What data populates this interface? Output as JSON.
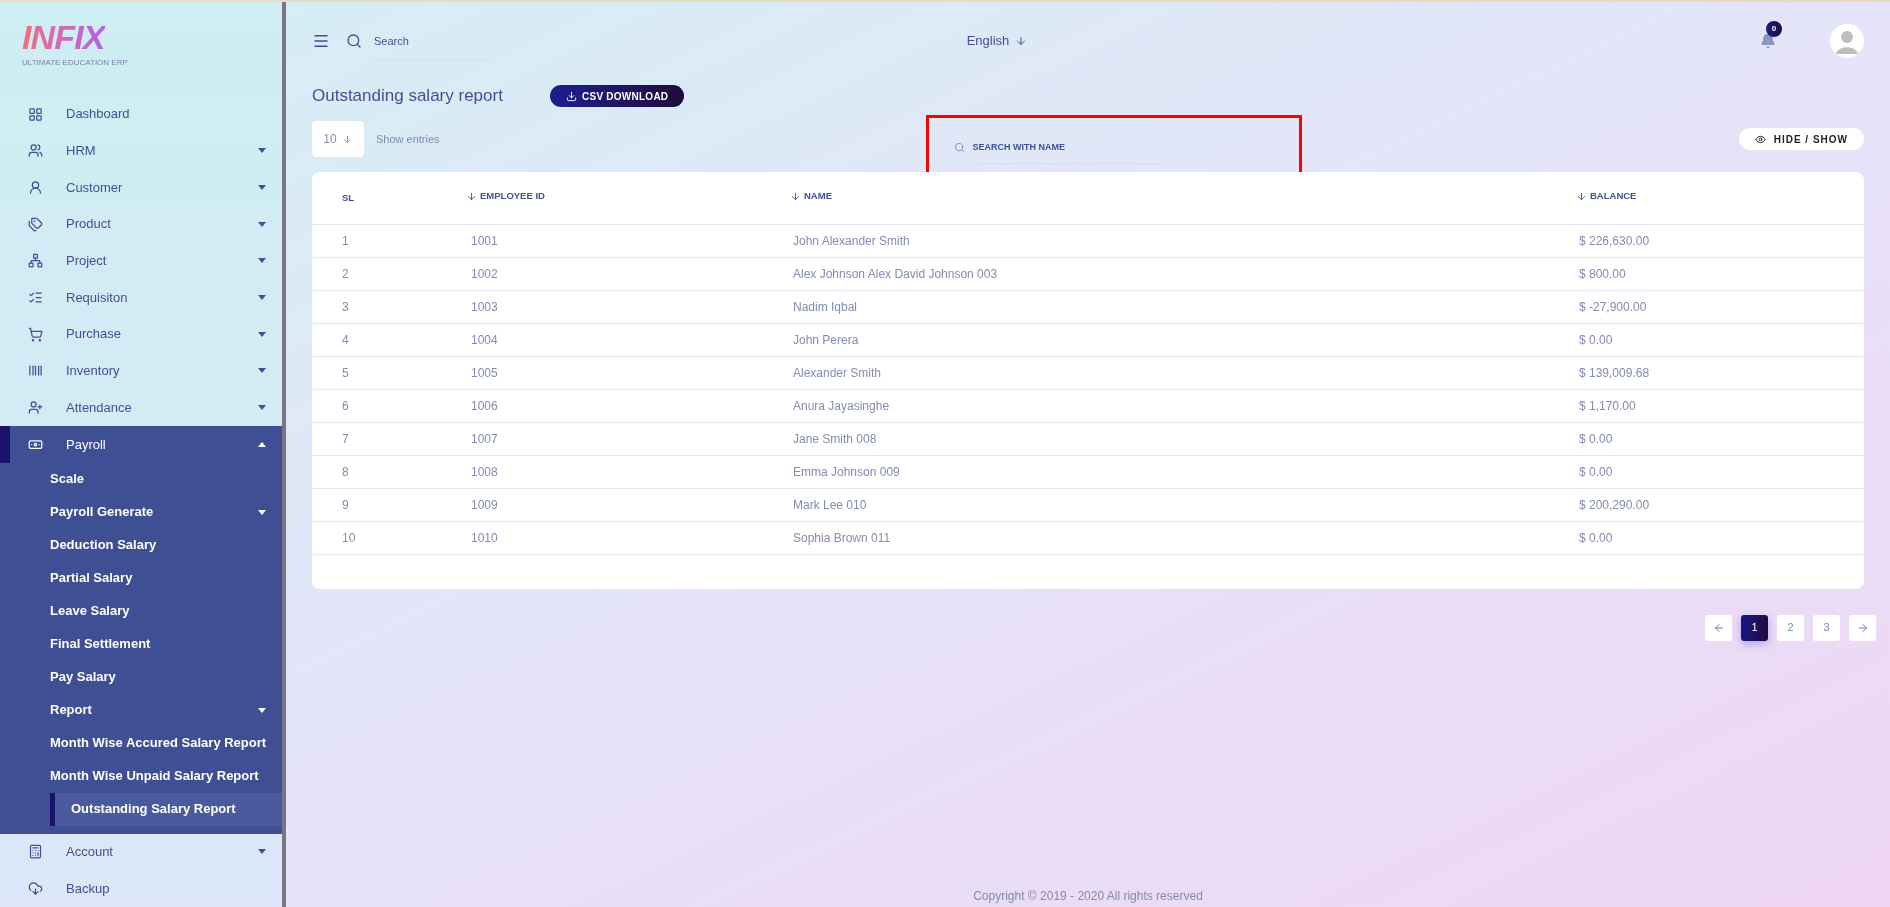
{
  "logo": {
    "wordmark": "INFIX",
    "tagline": "ULTIMATE EDUCATION ERP"
  },
  "sidebar": {
    "items": [
      {
        "label": "Dashboard",
        "has_submenu": false,
        "expanded": false
      },
      {
        "label": "HRM",
        "has_submenu": true,
        "expanded": false
      },
      {
        "label": "Customer",
        "has_submenu": true,
        "expanded": false
      },
      {
        "label": "Product",
        "has_submenu": true,
        "expanded": false
      },
      {
        "label": "Project",
        "has_submenu": true,
        "expanded": false
      },
      {
        "label": "Requisiton",
        "has_submenu": true,
        "expanded": false
      },
      {
        "label": "Purchase",
        "has_submenu": true,
        "expanded": false
      },
      {
        "label": "Inventory",
        "has_submenu": true,
        "expanded": false
      },
      {
        "label": "Attendance",
        "has_submenu": true,
        "expanded": false
      },
      {
        "label": "Payroll",
        "has_submenu": true,
        "expanded": true,
        "children": [
          {
            "label": "Scale",
            "has_submenu": false,
            "selected": false
          },
          {
            "label": "Payroll Generate",
            "has_submenu": true,
            "selected": false
          },
          {
            "label": "Deduction Salary",
            "has_submenu": false,
            "selected": false
          },
          {
            "label": "Partial Salary",
            "has_submenu": false,
            "selected": false
          },
          {
            "label": "Leave Salary",
            "has_submenu": false,
            "selected": false
          },
          {
            "label": "Final Settlement",
            "has_submenu": false,
            "selected": false
          },
          {
            "label": "Pay Salary",
            "has_submenu": false,
            "selected": false
          },
          {
            "label": "Report",
            "has_submenu": true,
            "selected": false
          },
          {
            "label": "Month Wise Accured Salary Report",
            "has_submenu": false,
            "selected": false
          },
          {
            "label": "Month Wise Unpaid Salary Report",
            "has_submenu": false,
            "selected": false
          },
          {
            "label": "Outstanding Salary Report",
            "has_submenu": false,
            "selected": true
          }
        ]
      },
      {
        "label": "Account",
        "has_submenu": true,
        "expanded": false
      },
      {
        "label": "Backup",
        "has_submenu": false,
        "expanded": false
      }
    ]
  },
  "topbar": {
    "search_placeholder": "Search",
    "language": "English",
    "notification_count": "0"
  },
  "page": {
    "title": "Outstanding salary report",
    "csv_button": "CSV DOWNLOAD",
    "entries_value": "10",
    "entries_label": "Show entries",
    "name_search_placeholder": "SEARCH WITH NAME",
    "hide_show_button": "HIDE / SHOW"
  },
  "table": {
    "columns": [
      {
        "label": "SL",
        "sortable": false
      },
      {
        "label": "EMPLOYEE ID",
        "sortable": true
      },
      {
        "label": "NAME",
        "sortable": true
      },
      {
        "label": "BALANCE",
        "sortable": true
      }
    ],
    "rows": [
      [
        "1",
        "1001",
        "John Alexander Smith",
        "$ 226,630.00"
      ],
      [
        "2",
        "1002",
        "Alex Johnson Alex David Johnson 003",
        "$ 800.00"
      ],
      [
        "3",
        "1003",
        "Nadim Iqbal",
        "$ -27,900.00"
      ],
      [
        "4",
        "1004",
        "John Perera",
        "$ 0.00"
      ],
      [
        "5",
        "1005",
        "Alexander Smith",
        "$ 139,009.68"
      ],
      [
        "6",
        "1006",
        "Anura Jayasinghe",
        "$ 1,170.00"
      ],
      [
        "7",
        "1007",
        "Jane Smith 008",
        "$ 0.00"
      ],
      [
        "8",
        "1008",
        "Emma Johnson 009",
        "$ 0.00"
      ],
      [
        "9",
        "1009",
        "Mark Lee 010",
        "$ 200,290.00"
      ],
      [
        "10",
        "1010",
        "Sophia Brown 011",
        "$ 0.00"
      ]
    ]
  },
  "pagination": {
    "pages": [
      {
        "label": "1",
        "selected": true
      },
      {
        "label": "2",
        "selected": false
      },
      {
        "label": "3",
        "selected": false
      }
    ]
  },
  "footer": "Copyright © 2019 - 2020 All rights reserved"
}
